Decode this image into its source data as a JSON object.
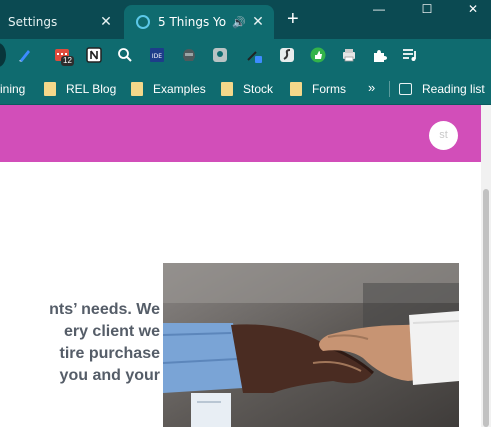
{
  "tabs": [
    {
      "title": "Settings",
      "close": "✕"
    },
    {
      "title": "5 Things Yo",
      "close": "✕",
      "audio": "🔊"
    }
  ],
  "new_tab": "+",
  "window_controls": {
    "minimize": "—",
    "maximize": "☐",
    "close": "✕"
  },
  "toolbar": {
    "badge_count": "12",
    "extensions": [
      "pen-icon",
      "calendar-icon",
      "notion-icon",
      "search-icon",
      "ide-icon",
      "helmet-icon",
      "shield-icon",
      "eyedropper-icon",
      "script-icon",
      "thumbs-up-icon",
      "printer-icon",
      "puzzle-icon",
      "playlist-icon"
    ]
  },
  "bookmarks": {
    "items": [
      "ining",
      "REL Blog",
      "Examples",
      "Stock",
      "Forms"
    ],
    "overflow": "»",
    "reading_list": "Reading list"
  },
  "page": {
    "accent_color": "#d24eb9",
    "avatar_initials": "st",
    "paragraph_lines": [
      "nts’ needs. We",
      "ery client we",
      "tire purchase",
      "you and your"
    ]
  }
}
